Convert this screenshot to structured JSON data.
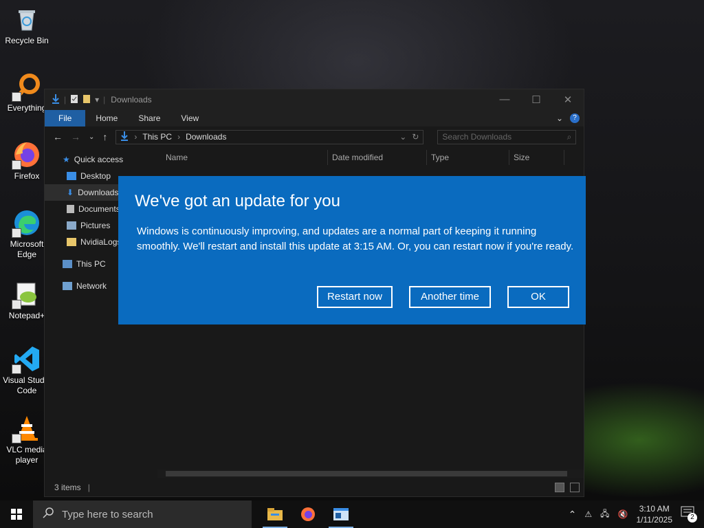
{
  "desktop": {
    "icons": [
      {
        "label": "Recycle Bin",
        "icon": "recycle-bin-icon"
      },
      {
        "label": "Everything",
        "icon": "everything-search-icon"
      },
      {
        "label": "Firefox",
        "icon": "firefox-icon"
      },
      {
        "label": "Microsoft Edge",
        "icon": "edge-icon"
      },
      {
        "label": "Notepad+",
        "icon": "notepad-plus-plus-icon"
      },
      {
        "label": "Visual Studio Code",
        "icon": "vscode-icon"
      },
      {
        "label": "VLC media player",
        "icon": "vlc-icon"
      }
    ]
  },
  "explorer": {
    "title": "Downloads",
    "ribbon_tabs": [
      "File",
      "Home",
      "Share",
      "View"
    ],
    "breadcrumb": [
      "This PC",
      "Downloads"
    ],
    "search_placeholder": "Search Downloads",
    "nav_items": [
      {
        "label": "Quick access",
        "icon": "star-icon"
      },
      {
        "label": "Desktop",
        "icon": "desktop-folder-icon"
      },
      {
        "label": "Downloads",
        "icon": "download-arrow-icon"
      },
      {
        "label": "Documents",
        "icon": "documents-icon"
      },
      {
        "label": "Pictures",
        "icon": "pictures-icon"
      },
      {
        "label": "NvidiaLogs",
        "icon": "folder-icon"
      },
      {
        "label": "This PC",
        "icon": "computer-icon"
      },
      {
        "label": "Network",
        "icon": "network-icon"
      }
    ],
    "columns": [
      "Name",
      "Date modified",
      "Type",
      "Size"
    ],
    "status": "3 items"
  },
  "dialog": {
    "title": "We've got an update for you",
    "message": "Windows is continuously improving, and updates are a normal part of keeping it running smoothly. We'll restart and install this update at 3:15 AM. Or, you can restart now if you're ready.",
    "buttons": {
      "restart": "Restart now",
      "another_time": "Another time",
      "ok": "OK"
    }
  },
  "taskbar": {
    "search_placeholder": "Type here to search",
    "time": "3:10 AM",
    "date": "1/11/2025",
    "notification_count": "2"
  },
  "colors": {
    "dialog_bg": "#0a6bbf",
    "accent": "#1f5fa3"
  }
}
